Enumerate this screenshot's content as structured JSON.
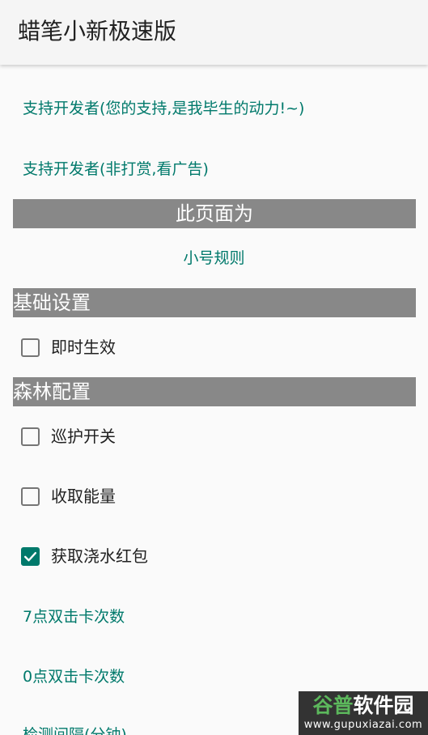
{
  "app": {
    "title": "蜡笔小新极速版"
  },
  "links": {
    "support_motivation": "支持开发者(您的支持,是我毕生的动力!~)",
    "support_ads": "支持开发者(非打赏,看广告)",
    "page_label": "此页面为",
    "alt_rules": "小号规则"
  },
  "sections": {
    "basic_settings": "基础设置",
    "forest_config": "森林配置"
  },
  "settings": {
    "instant_effect": {
      "label": "即时生效",
      "checked": false
    },
    "patrol_switch": {
      "label": "巡护开关",
      "checked": false
    },
    "collect_energy": {
      "label": "收取能量",
      "checked": false
    },
    "water_redpacket": {
      "label": "获取浇水红包",
      "checked": true
    }
  },
  "items": {
    "seven_double_click": "7点双击卡次数",
    "zero_double_click": "0点双击卡次数",
    "check_interval": "检测间隔(分钟)"
  },
  "watermark": {
    "part_a": "谷普",
    "part_b": "软件园",
    "url": "www.gupuxiazai.com"
  },
  "colors": {
    "accent": "#00796b",
    "header_bar": "#888888",
    "background": "#fafafa"
  }
}
